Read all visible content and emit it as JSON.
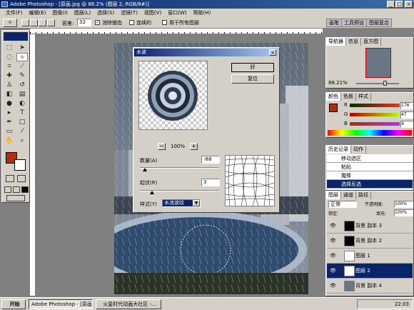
{
  "window": {
    "title": "Adobe Photoshop - [原画.jpg @ 88.2% (图层 2, RGB/8#)]",
    "min": "_",
    "max": "□",
    "close": "×"
  },
  "menu": [
    "文件(F)",
    "编辑(E)",
    "图像(I)",
    "图层(L)",
    "选择(S)",
    "滤镜(T)",
    "视图(V)",
    "窗口(W)",
    "帮助(H)"
  ],
  "options": {
    "tolerance_label": "容差:",
    "tolerance_value": "32",
    "antialias": "消除锯齿",
    "contiguous": "连续的",
    "all_layers": "用于所有图层",
    "tabs": [
      "画笔",
      "工具预设",
      "图层复合"
    ]
  },
  "dialog": {
    "title": "水波",
    "ok": "好",
    "reset": "复位",
    "zoom_minus": "−",
    "zoom": "100%",
    "zoom_plus": "+",
    "amount_label": "数量(A)",
    "amount_value": "-88",
    "ridges_label": "起伏(R)",
    "ridges_value": "3",
    "style_label": "样式(Y)",
    "style_value": "水池波纹",
    "amount_fraction": 0.06,
    "ridges_fraction": 0.15
  },
  "navigator": {
    "tabs": [
      "导航器",
      "信息",
      "直方图"
    ],
    "zoom": "88.21%"
  },
  "color": {
    "tabs": [
      "颜色",
      "色板",
      "样式"
    ],
    "r_label": "R",
    "r": "176",
    "g_label": "G",
    "g": "47",
    "b_label": "B",
    "b": "4",
    "fg": "#b02f04"
  },
  "history": {
    "tabs": [
      "历史记录",
      "动作"
    ],
    "items": [
      "移动选区",
      "粘贴",
      "魔棒",
      "选择反选"
    ],
    "selected_index": 3
  },
  "layers": {
    "tabs": [
      "图层",
      "通道",
      "路径"
    ],
    "blend": "正常",
    "opacity_label": "不透明度:",
    "opacity": "100%",
    "lock_label": "锁定:",
    "fill_label": "填充:",
    "fill": "100%",
    "items": [
      "背景 副本 3",
      "背景 副本 2",
      "图层 1",
      "图层 2",
      "背景 副本 4"
    ],
    "selected_index": 3
  },
  "taskbar": {
    "start": "开始",
    "items": [
      "Adobe Photoshop - [原画...",
      "火星时代动画大社区 -..."
    ],
    "clock": "22:03"
  }
}
